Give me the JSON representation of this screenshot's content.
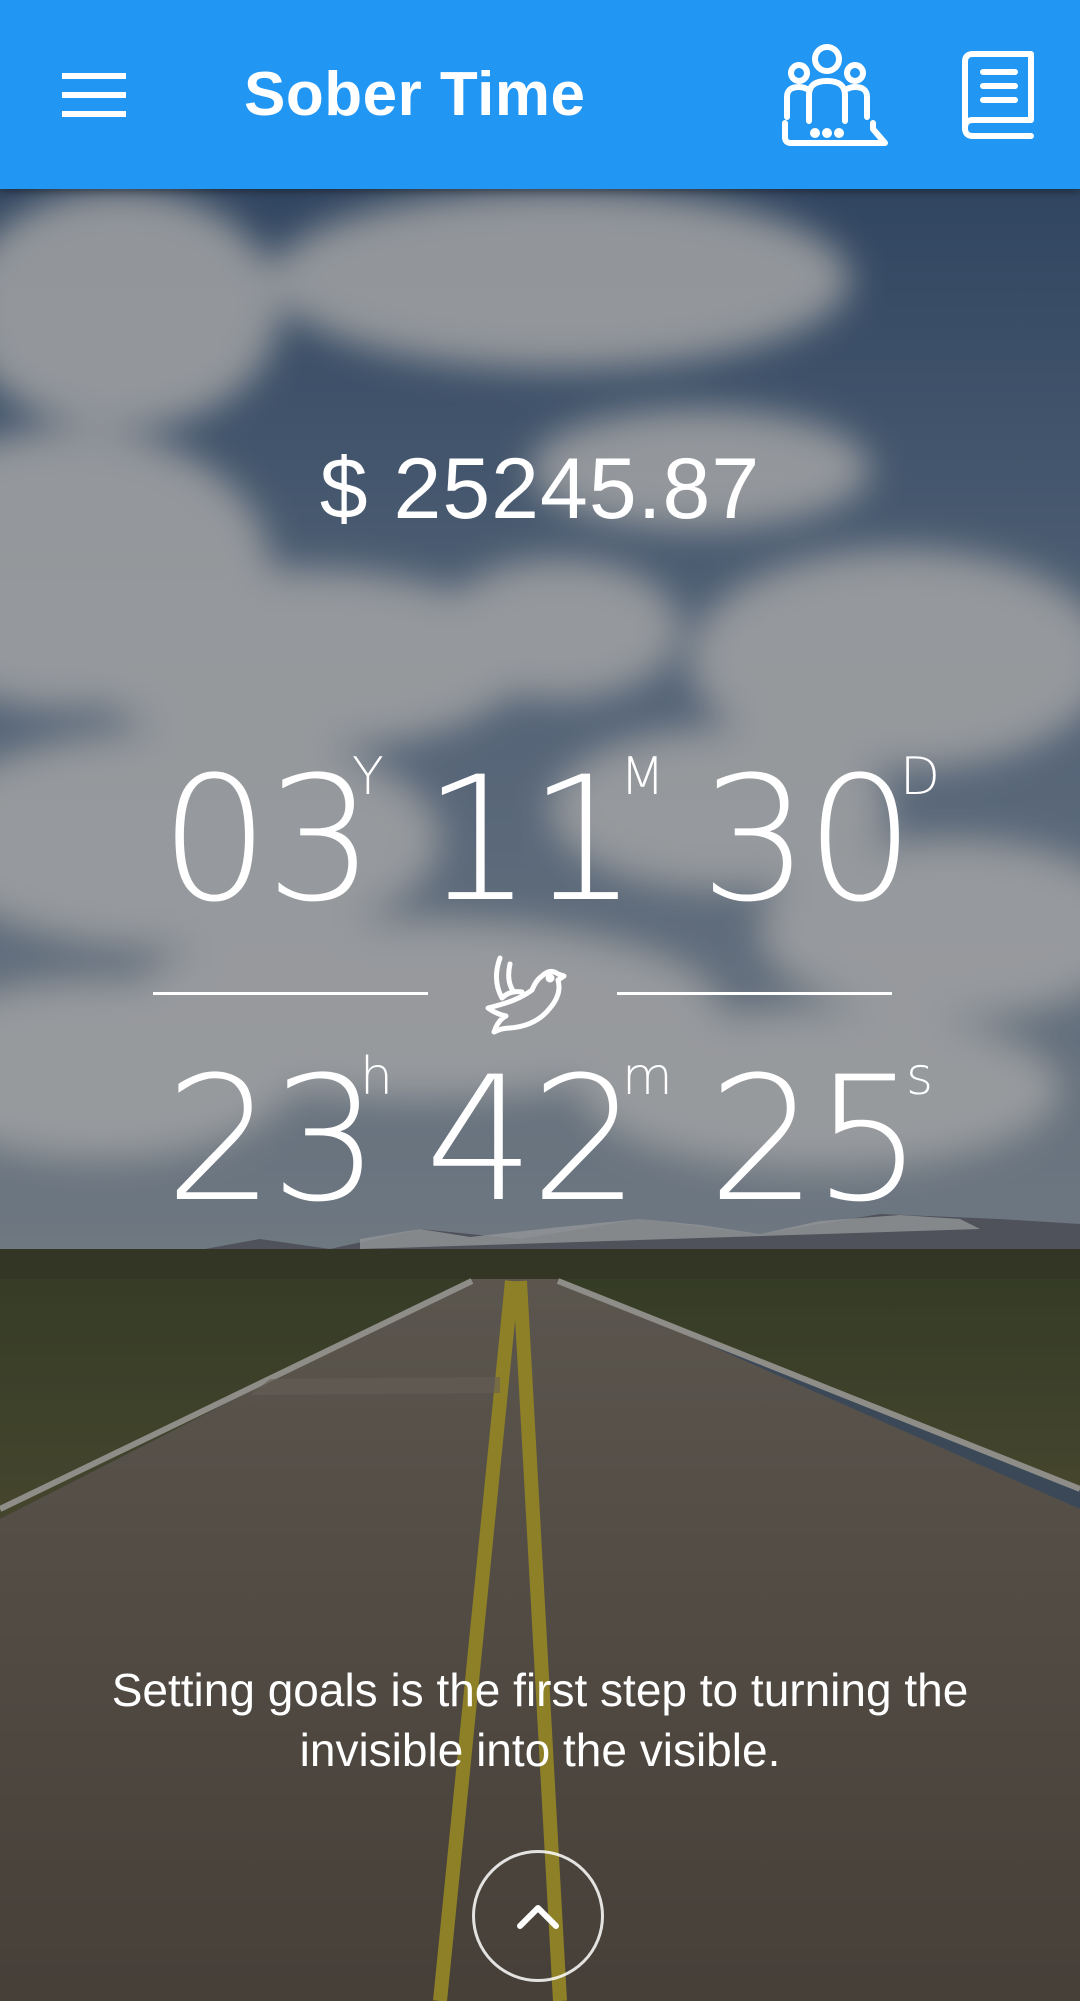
{
  "app_bar": {
    "title": "Sober Time",
    "menu_icon": "hamburger-menu-icon",
    "community_icon": "community-chat-icon",
    "book_icon": "book-icon",
    "color": "#2196f3"
  },
  "savings": {
    "text": "$ 25245.87"
  },
  "timer": {
    "years": {
      "value": "03",
      "suffix": "Y"
    },
    "months": {
      "value": "11",
      "suffix": "M"
    },
    "days": {
      "value": "30",
      "suffix": "D"
    },
    "hours": {
      "value": "23",
      "suffix": "h"
    },
    "minutes": {
      "value": "42",
      "suffix": "m"
    },
    "seconds": {
      "value": "25",
      "suffix": "s"
    },
    "divider_icon": "dove-icon"
  },
  "quote": {
    "line1": "Setting goals is the first step to turning the",
    "line2": "invisible into the visible."
  },
  "expand_button": {
    "icon": "chevron-up-icon"
  }
}
